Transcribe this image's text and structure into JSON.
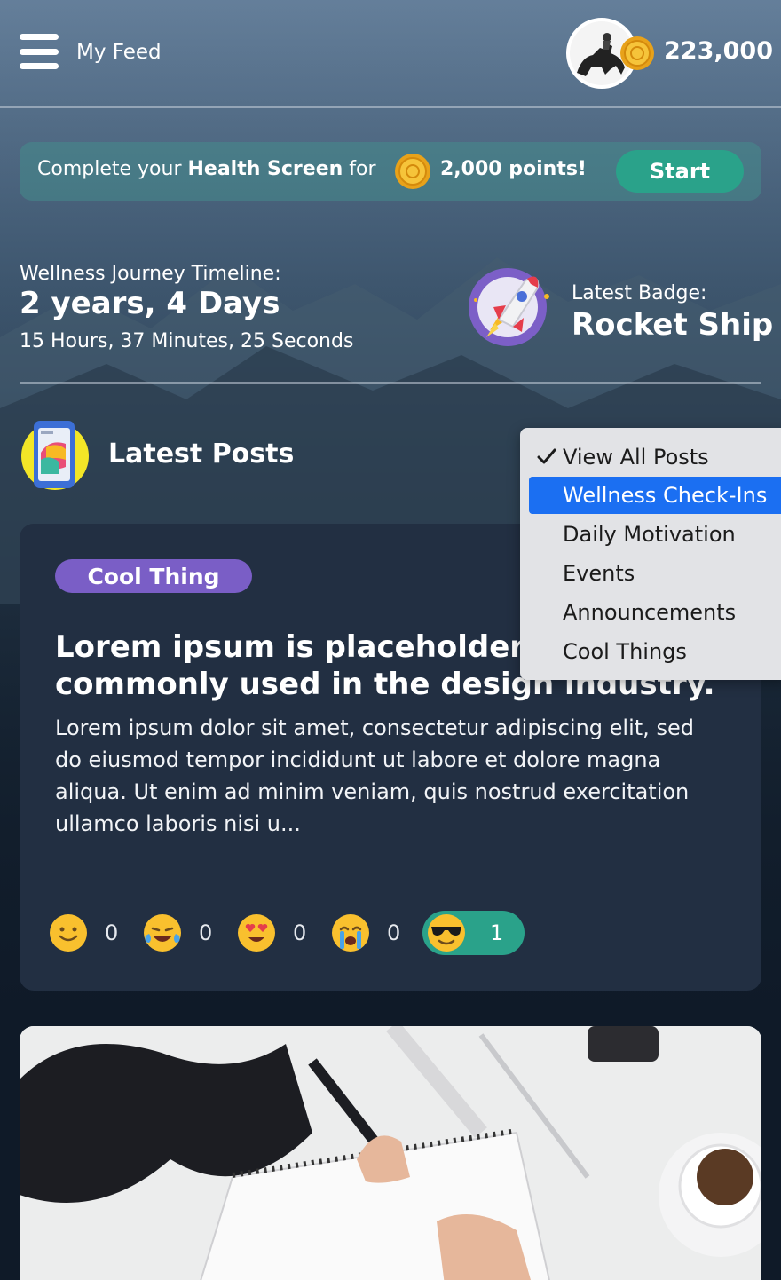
{
  "header": {
    "menu_icon": "hamburger-menu-icon",
    "title": "My Feed",
    "points": "223,000",
    "coin_icon": "coin-icon"
  },
  "banner": {
    "prefix": "Complete your ",
    "emphasis": "Health Screen",
    "suffix": " for",
    "points": "2,000 points!",
    "start_label": "Start"
  },
  "timeline": {
    "label": "Wellness Journey Timeline:",
    "duration": "2 years, 4 Days",
    "detail": "15 Hours, 37 Minutes, 25 Seconds"
  },
  "badge": {
    "label": "Latest Badge:",
    "name": "Rocket Ship",
    "icon": "rocket-ship-badge-icon"
  },
  "posts": {
    "title": "Latest Posts",
    "icon": "phone-posts-icon"
  },
  "post": {
    "tag": "Cool Thing",
    "title": "Lorem ipsum is placeholder text commonly used in the design industry.",
    "body": "Lorem ipsum dolor sit amet, consectetur adipiscing elit, sed do eiusmod tempor incididunt ut labore et dolore magna aliqua. Ut enim ad minim veniam, quis nostrud exercitation ullamco laboris nisi u...",
    "reactions": [
      {
        "icon": "smile-emoji-icon",
        "count": "0"
      },
      {
        "icon": "laughing-tears-emoji-icon",
        "count": "0"
      },
      {
        "icon": "heart-eyes-emoji-icon",
        "count": "0"
      },
      {
        "icon": "crying-emoji-icon",
        "count": "0"
      },
      {
        "icon": "sunglasses-emoji-icon",
        "count": "1",
        "active": true
      }
    ]
  },
  "filter_menu": {
    "items": [
      {
        "label": "View All Posts",
        "checked": true
      },
      {
        "label": "Wellness Check-Ins",
        "highlighted": true
      },
      {
        "label": "Daily Motivation"
      },
      {
        "label": "Events"
      },
      {
        "label": "Announcements"
      },
      {
        "label": "Cool Things"
      }
    ]
  },
  "colors": {
    "accent_green": "#2aa28a",
    "tag_purple": "#7a5ec6",
    "card_bg": "#222f42",
    "menu_highlight": "#1b6ff2"
  }
}
